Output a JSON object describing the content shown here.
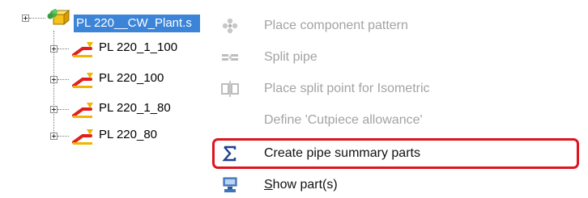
{
  "tree": {
    "root": {
      "label": "PL 220__CW_Plant.s"
    },
    "children": [
      {
        "label": "PL 220_1_100"
      },
      {
        "label": "PL 220_100"
      },
      {
        "label": "PL 220_1_80"
      },
      {
        "label": "PL 220_80"
      }
    ]
  },
  "menu": {
    "items": [
      {
        "label": "Place component pattern",
        "enabled": false,
        "icon": "component-pattern-icon"
      },
      {
        "label": "Split pipe",
        "enabled": false,
        "icon": "split-pipe-icon"
      },
      {
        "label": "Place split point for Isometric",
        "enabled": false,
        "icon": "split-point-icon"
      },
      {
        "label": "Define 'Cutpiece allowance'",
        "enabled": false,
        "icon": ""
      },
      {
        "label": "Create pipe summary parts",
        "enabled": true,
        "icon": "sigma-icon",
        "highlighted": true
      },
      {
        "label_prefix": "S",
        "label_rest": "how part(s)",
        "enabled": true,
        "icon": "show-parts-icon"
      }
    ]
  },
  "colors": {
    "selection": "#3b84d8",
    "highlight_border": "#e0141e",
    "disabled_text": "#a3a3a3"
  }
}
